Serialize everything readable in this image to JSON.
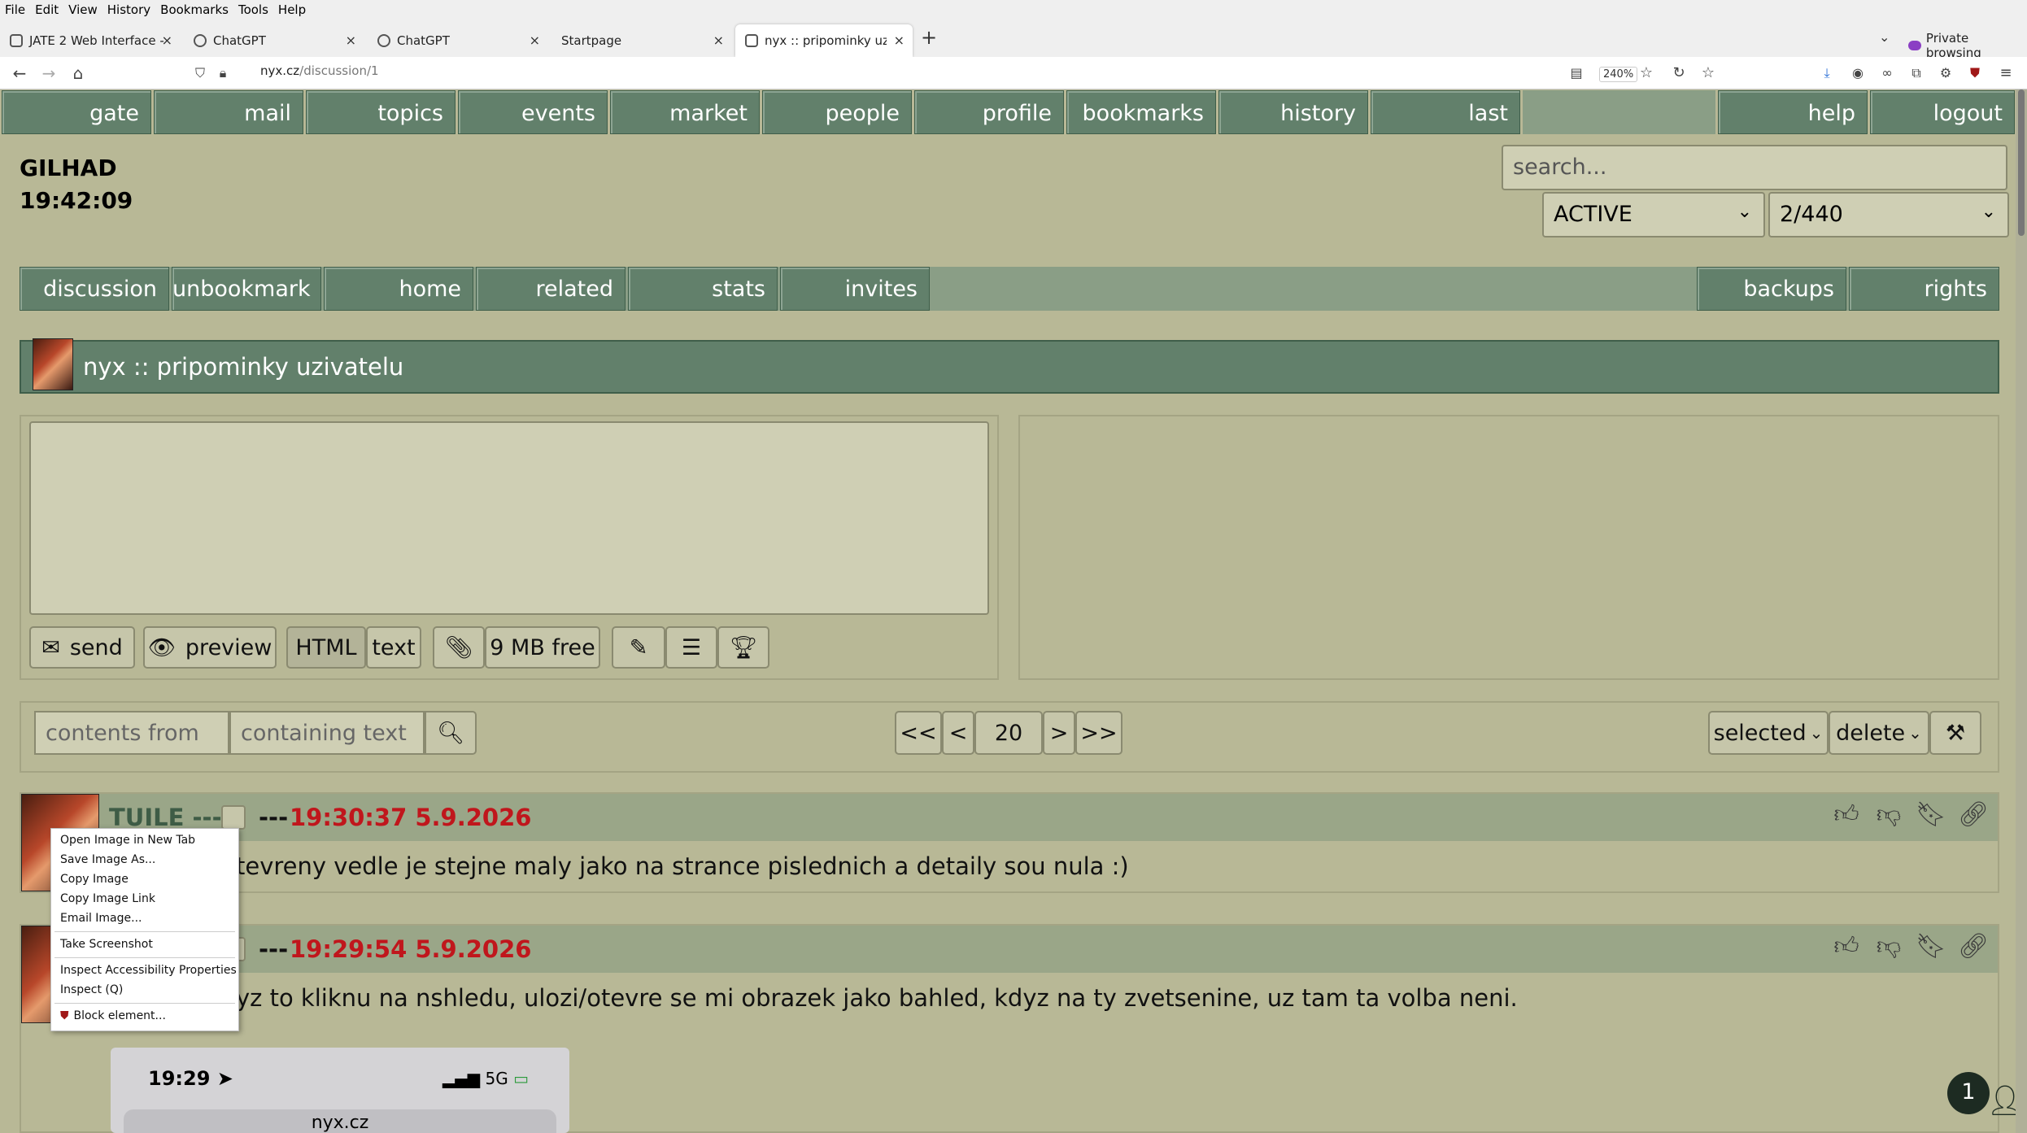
{
  "browser": {
    "menu": [
      "File",
      "Edit",
      "View",
      "History",
      "Bookmarks",
      "Tools",
      "Help"
    ],
    "tabs": [
      {
        "title": "JATE 2 Web Interface -"
      },
      {
        "title": "ChatGPT"
      },
      {
        "title": "ChatGPT"
      },
      {
        "title": "Startpage"
      },
      {
        "title": "nyx :: pripominky uzivatelu"
      }
    ],
    "new_tab": "+",
    "private": "Private browsing",
    "url_host": "nyx.cz",
    "url_path": "/discussion/1",
    "zoom": "240%"
  },
  "topnav": [
    "gate",
    "mail",
    "topics",
    "events",
    "market",
    "people",
    "profile",
    "bookmarks",
    "history",
    "last",
    "help",
    "logout"
  ],
  "user": {
    "name": "GILHAD",
    "time": "19:42:09"
  },
  "search_placeholder": "search...",
  "status_select": "ACTIVE",
  "page_select": "2/440",
  "subnav": {
    "left": [
      "discussion",
      "unbookmark",
      "home",
      "related",
      "stats",
      "invites"
    ],
    "right": [
      "backups",
      "rights"
    ]
  },
  "discussion_title": "nyx :: pripominky uzivatelu",
  "composer": {
    "send": "send",
    "preview": "preview",
    "html": "HTML",
    "text": "text",
    "free": "9 MB free"
  },
  "filter": {
    "from_placeholder": "contents from",
    "text_placeholder": "containing text",
    "first": "<<",
    "prev": "<",
    "count": "20",
    "next": ">",
    "last": ">>",
    "selected": "selected",
    "delete": "delete"
  },
  "posts": [
    {
      "author": "TUILE ---",
      "sep": "---",
      "time": "19:30:37 5.9.2026",
      "text": "tevreny vedle je stejne maly jako na strance pislednich a detaily sou nula :)"
    },
    {
      "sep": "---",
      "time": "19:29:54 5.9.2026",
      "text": "yz to kliknu na nshledu, ulozi/otevre se mi obrazek jako bahled, kdyz na ty zvetsenine, uz tam ta volba neni."
    }
  ],
  "context_menu": [
    "Open Image in New Tab",
    "Save Image As...",
    "Copy Image",
    "Copy Image Link",
    "Email Image...",
    "Take Screenshot",
    "Inspect Accessibility Properties",
    "Inspect (Q)",
    "Block element..."
  ],
  "phone": {
    "time": "19:29",
    "signal": "5G",
    "url": "nyx.cz"
  },
  "badge": "1"
}
